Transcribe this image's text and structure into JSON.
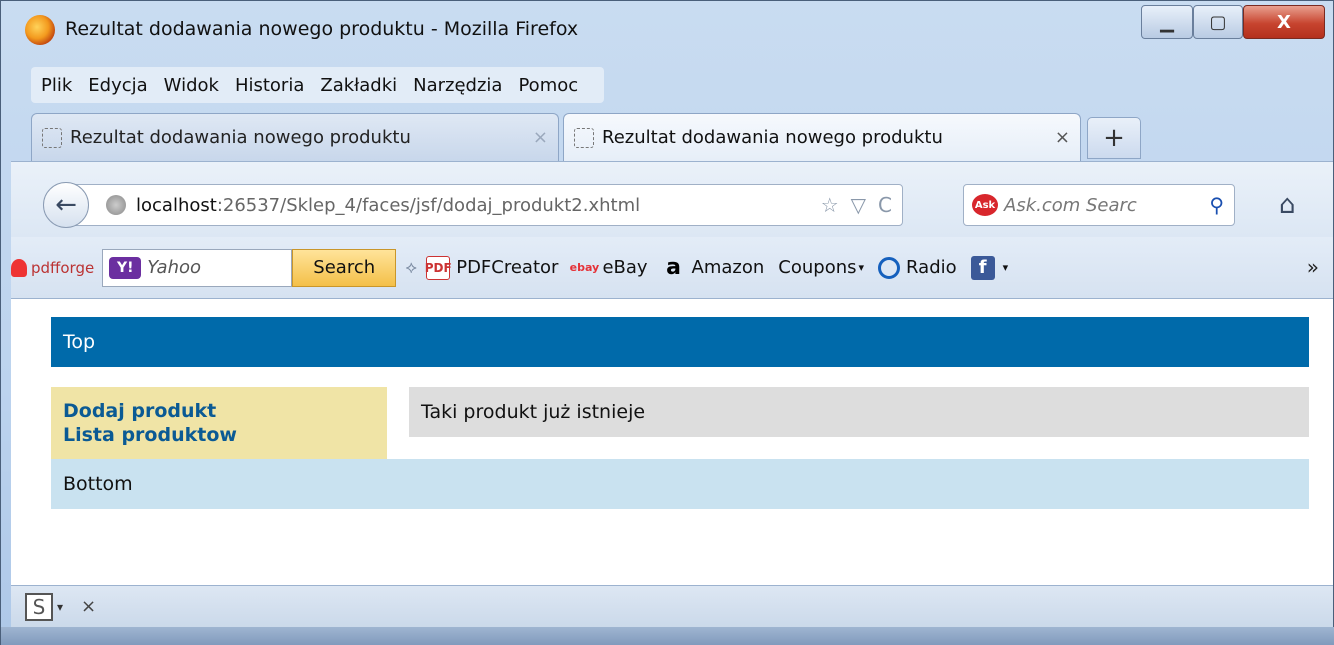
{
  "window": {
    "title": "Rezultat dodawania nowego produktu - Mozilla Firefox",
    "minimize_glyph": "▁",
    "maximize_glyph": "▢",
    "close_glyph": "X"
  },
  "menubar": {
    "items": [
      "Plik",
      "Edycja",
      "Widok",
      "Historia",
      "Zakładki",
      "Narzędzia",
      "Pomoc"
    ]
  },
  "tabs": [
    {
      "label": "Rezultat dodawania nowego produktu",
      "active": false
    },
    {
      "label": "Rezultat dodawania nowego produktu",
      "active": true
    }
  ],
  "tab_close_glyph": "×",
  "new_tab_glyph": "+",
  "navbar": {
    "back_glyph": "←",
    "url_host": "localhost",
    "url_path": ":26537/Sklep_4/faces/jsf/dodaj_produkt2.xhtml",
    "star_glyph": "☆",
    "dropdown_glyph": "▽",
    "reload_glyph": "C",
    "search_engine_badge": "Ask",
    "search_placeholder": "Ask.com Searc",
    "magnifier_glyph": "⚲",
    "home_glyph": "⌂"
  },
  "bookmarks": {
    "pdfforge_label": "pdfforge",
    "yahoo_logo": "Y!",
    "yahoo_text": "Yahoo",
    "yahoo_search_button": "Search",
    "separator_glyph": "⟡",
    "items": [
      {
        "label": "PDFCreator",
        "icon": "PDF"
      },
      {
        "label": "eBay",
        "icon": "ebay"
      },
      {
        "label": "Amazon",
        "icon": "a"
      },
      {
        "label": "Coupons",
        "icon": ""
      },
      {
        "label": "Radio",
        "icon": ""
      },
      {
        "label": "",
        "icon": "f"
      }
    ],
    "more_glyph": "»"
  },
  "page": {
    "top_label": "Top",
    "menu_links": [
      "Dodaj produkt",
      "Lista produktow"
    ],
    "message": "Taki produkt już istnieje",
    "bottom_label": "Bottom"
  },
  "statusbar": {
    "addon_icon_glyph": "S",
    "caret_glyph": "▾",
    "close_glyph": "×"
  }
}
